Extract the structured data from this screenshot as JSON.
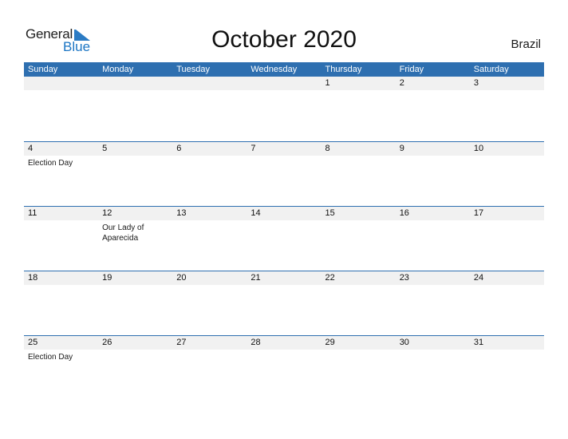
{
  "logo": {
    "general": "General",
    "blue": "Blue"
  },
  "title": "October 2020",
  "country": "Brazil",
  "colors": {
    "accent": "#2e6fb0",
    "band": "#f1f1f1"
  },
  "weekdays": [
    "Sunday",
    "Monday",
    "Tuesday",
    "Wednesday",
    "Thursday",
    "Friday",
    "Saturday"
  ],
  "weeks": [
    {
      "days": [
        {
          "num": "",
          "hol": ""
        },
        {
          "num": "",
          "hol": ""
        },
        {
          "num": "",
          "hol": ""
        },
        {
          "num": "",
          "hol": ""
        },
        {
          "num": "1",
          "hol": ""
        },
        {
          "num": "2",
          "hol": ""
        },
        {
          "num": "3",
          "hol": ""
        }
      ]
    },
    {
      "days": [
        {
          "num": "4",
          "hol": "Election Day"
        },
        {
          "num": "5",
          "hol": ""
        },
        {
          "num": "6",
          "hol": ""
        },
        {
          "num": "7",
          "hol": ""
        },
        {
          "num": "8",
          "hol": ""
        },
        {
          "num": "9",
          "hol": ""
        },
        {
          "num": "10",
          "hol": ""
        }
      ]
    },
    {
      "days": [
        {
          "num": "11",
          "hol": ""
        },
        {
          "num": "12",
          "hol": "Our Lady of Aparecida"
        },
        {
          "num": "13",
          "hol": ""
        },
        {
          "num": "14",
          "hol": ""
        },
        {
          "num": "15",
          "hol": ""
        },
        {
          "num": "16",
          "hol": ""
        },
        {
          "num": "17",
          "hol": ""
        }
      ]
    },
    {
      "days": [
        {
          "num": "18",
          "hol": ""
        },
        {
          "num": "19",
          "hol": ""
        },
        {
          "num": "20",
          "hol": ""
        },
        {
          "num": "21",
          "hol": ""
        },
        {
          "num": "22",
          "hol": ""
        },
        {
          "num": "23",
          "hol": ""
        },
        {
          "num": "24",
          "hol": ""
        }
      ]
    },
    {
      "days": [
        {
          "num": "25",
          "hol": "Election Day"
        },
        {
          "num": "26",
          "hol": ""
        },
        {
          "num": "27",
          "hol": ""
        },
        {
          "num": "28",
          "hol": ""
        },
        {
          "num": "29",
          "hol": ""
        },
        {
          "num": "30",
          "hol": ""
        },
        {
          "num": "31",
          "hol": ""
        }
      ]
    }
  ]
}
